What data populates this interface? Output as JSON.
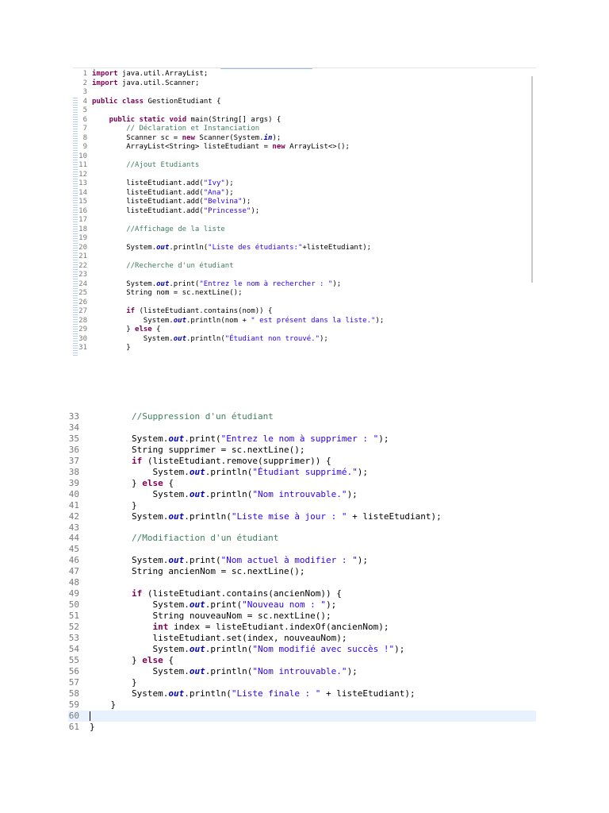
{
  "snippet1": {
    "lines": [
      {
        "n": "1",
        "i": 0,
        "t": [
          [
            "k",
            "import"
          ],
          [
            "p",
            " java.util.ArrayList;"
          ]
        ]
      },
      {
        "n": "2",
        "i": 0,
        "t": [
          [
            "k",
            "import"
          ],
          [
            "p",
            " java.util.Scanner;"
          ]
        ]
      },
      {
        "n": "3",
        "i": 0,
        "t": []
      },
      {
        "n": "4",
        "i": 0,
        "t": [
          [
            "k",
            "public class"
          ],
          [
            "p",
            " GestionEtudiant {"
          ]
        ]
      },
      {
        "n": "5",
        "i": 0,
        "t": []
      },
      {
        "n": "6",
        "i": 1,
        "t": [
          [
            "k",
            "public static void"
          ],
          [
            "p",
            " main(String[] args) {"
          ]
        ]
      },
      {
        "n": "7",
        "i": 2,
        "t": [
          [
            "c",
            "// Déclaration et Instanciation"
          ]
        ]
      },
      {
        "n": "8",
        "i": 2,
        "t": [
          [
            "p",
            "Scanner sc = "
          ],
          [
            "k",
            "new"
          ],
          [
            "p",
            " Scanner(System."
          ],
          [
            "f",
            "in"
          ],
          [
            "p",
            ");"
          ]
        ]
      },
      {
        "n": "9",
        "i": 2,
        "t": [
          [
            "p",
            "ArrayList<String> listeEtudiant = "
          ],
          [
            "k",
            "new"
          ],
          [
            "p",
            " ArrayList<>();"
          ]
        ]
      },
      {
        "n": "10",
        "i": 0,
        "t": []
      },
      {
        "n": "11",
        "i": 2,
        "t": [
          [
            "c",
            "//Ajout Etudiants"
          ]
        ]
      },
      {
        "n": "12",
        "i": 0,
        "t": []
      },
      {
        "n": "13",
        "i": 2,
        "t": [
          [
            "p",
            "listeEtudiant.add("
          ],
          [
            "s",
            "\"Ivy\""
          ],
          [
            "p",
            ");"
          ]
        ]
      },
      {
        "n": "14",
        "i": 2,
        "t": [
          [
            "p",
            "listeEtudiant.add("
          ],
          [
            "s",
            "\"Ana\""
          ],
          [
            "p",
            ");"
          ]
        ]
      },
      {
        "n": "15",
        "i": 2,
        "t": [
          [
            "p",
            "listeEtudiant.add("
          ],
          [
            "s",
            "\"Belvina\""
          ],
          [
            "p",
            ");"
          ]
        ]
      },
      {
        "n": "16",
        "i": 2,
        "t": [
          [
            "p",
            "listeEtudiant.add("
          ],
          [
            "s",
            "\"Princesse\""
          ],
          [
            "p",
            ");"
          ]
        ]
      },
      {
        "n": "17",
        "i": 0,
        "t": []
      },
      {
        "n": "18",
        "i": 2,
        "t": [
          [
            "c",
            "//Affichage de la liste"
          ]
        ]
      },
      {
        "n": "19",
        "i": 0,
        "t": []
      },
      {
        "n": "20",
        "i": 2,
        "t": [
          [
            "p",
            "System."
          ],
          [
            "f",
            "out"
          ],
          [
            "p",
            ".println("
          ],
          [
            "s",
            "\"Liste des étudiants:\""
          ],
          [
            "p",
            "+listeEtudiant);"
          ]
        ]
      },
      {
        "n": "21",
        "i": 0,
        "t": []
      },
      {
        "n": "22",
        "i": 2,
        "t": [
          [
            "c",
            "//Recherche d'un étudiant"
          ]
        ]
      },
      {
        "n": "23",
        "i": 0,
        "t": []
      },
      {
        "n": "24",
        "i": 2,
        "t": [
          [
            "p",
            "System."
          ],
          [
            "f",
            "out"
          ],
          [
            "p",
            ".print("
          ],
          [
            "s",
            "\"Entrez le nom à rechercher : \""
          ],
          [
            "p",
            ");"
          ]
        ]
      },
      {
        "n": "25",
        "i": 2,
        "t": [
          [
            "p",
            "String nom = sc.nextLine();"
          ]
        ]
      },
      {
        "n": "26",
        "i": 0,
        "t": []
      },
      {
        "n": "27",
        "i": 2,
        "t": [
          [
            "k",
            "if"
          ],
          [
            "p",
            " (listeEtudiant.contains(nom)) {"
          ]
        ]
      },
      {
        "n": "28",
        "i": 3,
        "t": [
          [
            "p",
            "System."
          ],
          [
            "f",
            "out"
          ],
          [
            "p",
            ".println(nom + "
          ],
          [
            "s",
            "\" est présent dans la liste.\""
          ],
          [
            "p",
            ");"
          ]
        ]
      },
      {
        "n": "29",
        "i": 2,
        "t": [
          [
            "p",
            "} "
          ],
          [
            "k",
            "else"
          ],
          [
            "p",
            " {"
          ]
        ]
      },
      {
        "n": "30",
        "i": 3,
        "t": [
          [
            "p",
            "System."
          ],
          [
            "f",
            "out"
          ],
          [
            "p",
            ".println("
          ],
          [
            "s",
            "\"Étudiant non trouvé.\""
          ],
          [
            "p",
            ");"
          ]
        ]
      },
      {
        "n": "31",
        "i": 2,
        "t": [
          [
            "p",
            "}"
          ]
        ]
      }
    ]
  },
  "snippet2": {
    "lines": [
      {
        "n": "33",
        "i": 2,
        "t": [
          [
            "c",
            "//Suppression d'un étudiant"
          ]
        ]
      },
      {
        "n": "34",
        "i": 0,
        "t": []
      },
      {
        "n": "35",
        "i": 2,
        "t": [
          [
            "p",
            "System."
          ],
          [
            "f",
            "out"
          ],
          [
            "p",
            ".print("
          ],
          [
            "s",
            "\"Entrez le nom à supprimer : \""
          ],
          [
            "p",
            ");"
          ]
        ]
      },
      {
        "n": "36",
        "i": 2,
        "t": [
          [
            "p",
            "String supprimer = sc.nextLine();"
          ]
        ]
      },
      {
        "n": "37",
        "i": 2,
        "t": [
          [
            "k",
            "if"
          ],
          [
            "p",
            " (listeEtudiant.remove(supprimer)) {"
          ]
        ]
      },
      {
        "n": "38",
        "i": 3,
        "t": [
          [
            "p",
            "System."
          ],
          [
            "f",
            "out"
          ],
          [
            "p",
            ".println("
          ],
          [
            "s",
            "\"Étudiant supprimé.\""
          ],
          [
            "p",
            ");"
          ]
        ]
      },
      {
        "n": "39",
        "i": 2,
        "t": [
          [
            "p",
            "} "
          ],
          [
            "k",
            "else"
          ],
          [
            "p",
            " {"
          ]
        ]
      },
      {
        "n": "40",
        "i": 3,
        "t": [
          [
            "p",
            "System."
          ],
          [
            "f",
            "out"
          ],
          [
            "p",
            ".println("
          ],
          [
            "s",
            "\"Nom introuvable.\""
          ],
          [
            "p",
            ");"
          ]
        ]
      },
      {
        "n": "41",
        "i": 2,
        "t": [
          [
            "p",
            "}"
          ]
        ]
      },
      {
        "n": "42",
        "i": 2,
        "t": [
          [
            "p",
            "System."
          ],
          [
            "f",
            "out"
          ],
          [
            "p",
            ".println("
          ],
          [
            "s",
            "\"Liste mise à jour : \""
          ],
          [
            "p",
            " + listeEtudiant);"
          ]
        ]
      },
      {
        "n": "43",
        "i": 0,
        "t": []
      },
      {
        "n": "44",
        "i": 2,
        "t": [
          [
            "c",
            "//Modifiaction d'un étudiant"
          ]
        ]
      },
      {
        "n": "45",
        "i": 0,
        "t": []
      },
      {
        "n": "46",
        "i": 2,
        "t": [
          [
            "p",
            "System."
          ],
          [
            "f",
            "out"
          ],
          [
            "p",
            ".print("
          ],
          [
            "s",
            "\"Nom actuel à modifier : \""
          ],
          [
            "p",
            ");"
          ]
        ]
      },
      {
        "n": "47",
        "i": 2,
        "t": [
          [
            "p",
            "String ancienNom = sc.nextLine();"
          ]
        ]
      },
      {
        "n": "48",
        "i": 0,
        "t": []
      },
      {
        "n": "49",
        "i": 2,
        "t": [
          [
            "k",
            "if"
          ],
          [
            "p",
            " (listeEtudiant.contains(ancienNom)) {"
          ]
        ]
      },
      {
        "n": "50",
        "i": 3,
        "t": [
          [
            "p",
            "System."
          ],
          [
            "f",
            "out"
          ],
          [
            "p",
            ".print("
          ],
          [
            "s",
            "\"Nouveau nom : \""
          ],
          [
            "p",
            ");"
          ]
        ]
      },
      {
        "n": "51",
        "i": 3,
        "t": [
          [
            "p",
            "String nouveauNom = sc.nextLine();"
          ]
        ]
      },
      {
        "n": "52",
        "i": 3,
        "t": [
          [
            "k",
            "int"
          ],
          [
            "p",
            " index = listeEtudiant.indexOf(ancienNom);"
          ]
        ]
      },
      {
        "n": "53",
        "i": 3,
        "t": [
          [
            "p",
            "listeEtudiant.set(index, nouveauNom);"
          ]
        ]
      },
      {
        "n": "54",
        "i": 3,
        "t": [
          [
            "p",
            "System."
          ],
          [
            "f",
            "out"
          ],
          [
            "p",
            ".println("
          ],
          [
            "s",
            "\"Nom modifié avec succès !\""
          ],
          [
            "p",
            ");"
          ]
        ]
      },
      {
        "n": "55",
        "i": 2,
        "t": [
          [
            "p",
            "} "
          ],
          [
            "k",
            "else"
          ],
          [
            "p",
            " {"
          ]
        ]
      },
      {
        "n": "56",
        "i": 3,
        "t": [
          [
            "p",
            "System."
          ],
          [
            "f",
            "out"
          ],
          [
            "p",
            ".println("
          ],
          [
            "s",
            "\"Nom introuvable.\""
          ],
          [
            "p",
            ");"
          ]
        ]
      },
      {
        "n": "57",
        "i": 2,
        "t": [
          [
            "p",
            "}"
          ]
        ]
      },
      {
        "n": "58",
        "i": 2,
        "t": [
          [
            "p",
            "System."
          ],
          [
            "f",
            "out"
          ],
          [
            "p",
            ".println("
          ],
          [
            "s",
            "\"Liste finale : \""
          ],
          [
            "p",
            " + listeEtudiant);"
          ]
        ]
      },
      {
        "n": "59",
        "i": 1,
        "t": [
          [
            "p",
            "}"
          ]
        ]
      },
      {
        "n": "60",
        "i": 0,
        "t": [],
        "current": true
      },
      {
        "n": "61",
        "i": 0,
        "t": [
          [
            "p",
            "}"
          ]
        ]
      }
    ]
  }
}
